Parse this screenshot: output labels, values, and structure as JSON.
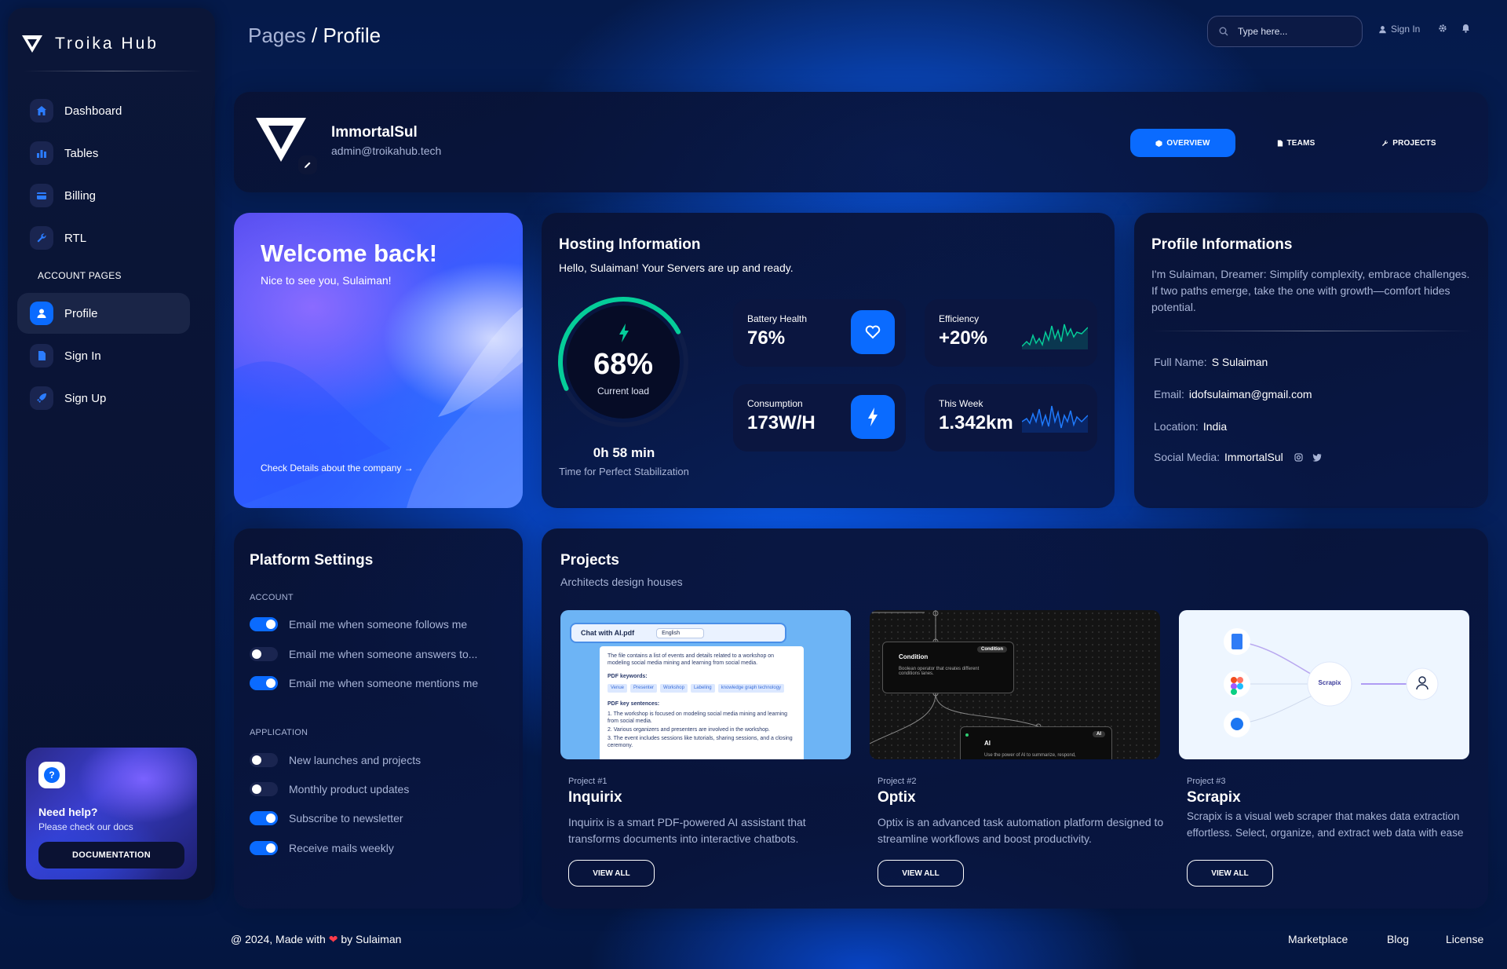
{
  "brand": {
    "title": "Troika Hub"
  },
  "sidebar": {
    "items": [
      {
        "label": "Dashboard",
        "icon": "home-icon"
      },
      {
        "label": "Tables",
        "icon": "chart-icon"
      },
      {
        "label": "Billing",
        "icon": "card-icon"
      },
      {
        "label": "RTL",
        "icon": "wrench-icon"
      }
    ],
    "section_label": "ACCOUNT PAGES",
    "account_items": [
      {
        "label": "Profile",
        "icon": "user-icon",
        "active": true
      },
      {
        "label": "Sign In",
        "icon": "document-icon"
      },
      {
        "label": "Sign Up",
        "icon": "rocket-icon"
      }
    ],
    "help": {
      "title": "Need help?",
      "subtitle": "Please check our docs",
      "button": "DOCUMENTATION",
      "icon": "question-icon"
    }
  },
  "header": {
    "breadcrumb_parent": "Pages",
    "breadcrumb_separator": "/",
    "breadcrumb_current": "Profile",
    "search_placeholder": "Type here...",
    "signin_label": "Sign In"
  },
  "profile": {
    "name": "ImmortalSul",
    "email": "admin@troikahub.tech",
    "tabs": [
      {
        "label": "OVERVIEW",
        "active": true
      },
      {
        "label": "TEAMS",
        "active": false
      },
      {
        "label": "PROJECTS",
        "active": false
      }
    ]
  },
  "welcome": {
    "title": "Welcome back!",
    "subtitle": "Nice to see you, Sulaiman!",
    "link": "Check Details about the company"
  },
  "hosting": {
    "title": "Hosting Information",
    "subtitle": "Hello, Sulaiman! Your Servers are up and ready.",
    "gauge_value": "68%",
    "gauge_fraction": 0.68,
    "gauge_label": "Current load",
    "time_value": "0h 58 min",
    "time_label": "Time for Perfect Stabilization",
    "stats": [
      {
        "label": "Battery Health",
        "value": "76%",
        "icon": "heart-icon"
      },
      {
        "label": "Efficiency",
        "value": "+20%",
        "icon": "green-sparkline"
      },
      {
        "label": "Consumption",
        "value": "173W/H",
        "icon": "bolt-icon"
      },
      {
        "label": "This Week",
        "value": "1.342km",
        "icon": "blue-sparkline"
      }
    ]
  },
  "profile_info": {
    "title": "Profile Informations",
    "description": "I'm Sulaiman, Dreamer: Simplify complexity, embrace challenges. If two paths emerge, take the one with growth—comfort hides potential.",
    "rows": [
      {
        "key": "Full Name:",
        "value": "S Sulaiman"
      },
      {
        "key": "Email:",
        "value": "idofsulaiman@gmail.com"
      },
      {
        "key": "Location:",
        "value": "India"
      },
      {
        "key": "Social Media:",
        "value": "ImmortalSul"
      }
    ]
  },
  "platform": {
    "title": "Platform Settings",
    "account_label": "ACCOUNT",
    "account": [
      {
        "label": "Email me when someone follows me",
        "on": true
      },
      {
        "label": "Email me when someone answers to...",
        "on": false
      },
      {
        "label": "Email me when someone mentions me",
        "on": true
      }
    ],
    "application_label": "APPLICATION",
    "application": [
      {
        "label": "New launches and projects",
        "on": false
      },
      {
        "label": "Monthly product updates",
        "on": false
      },
      {
        "label": "Subscribe to newsletter",
        "on": true
      },
      {
        "label": "Receive mails weekly",
        "on": true
      }
    ]
  },
  "projects": {
    "title": "Projects",
    "subtitle": "Architects design houses",
    "items": [
      {
        "num": "Project #1",
        "name": "Inquirix",
        "desc": "Inquirix is a smart PDF-powered AI assistant that transforms documents into interactive chatbots.",
        "button": "VIEW ALL"
      },
      {
        "num": "Project #2",
        "name": "Optix",
        "desc": "Optix is an advanced task automation platform designed to streamline workflows and boost productivity.",
        "button": "VIEW ALL"
      },
      {
        "num": "Project #3",
        "name": "Scrapix",
        "desc": "Scrapix is a visual web scraper that makes data extraction effortless. Select, organize, and extract web data with ease",
        "button": "VIEW ALL"
      }
    ],
    "thumb1": {
      "title": "Chat with AI.pdf",
      "lang": "English",
      "summary": "The file contains a list of events and details related to a workshop on modeling social media mining and learning from social media.",
      "keywords_label": "PDF keywords:",
      "keywords": [
        "Venue",
        "Presenter",
        "Workshop",
        "Labeling",
        "knowledge graph technology"
      ],
      "sentences_label": "PDF key sentences:",
      "sentences": [
        "1. The workshop is focused on modeling social media mining and learning from social media.",
        "2. Various organizers and presenters are involved in the workshop.",
        "3. The event includes sessions like tutorials, sharing sessions, and a closing ceremony."
      ]
    },
    "thumb2": {
      "node1_tag": "Condition",
      "node1_title": "Condition",
      "node1_desc": "Boolean operator that creates different conditions lanes.",
      "node2_tag": "AI",
      "node2_title": "AI",
      "node2_desc": "Use the power of AI to summarize, respond,"
    },
    "thumb3": {
      "center": "Scrapix"
    }
  },
  "footer": {
    "copyright_prefix": "@ 2024, Made with",
    "copyright_suffix": "by Sulaiman",
    "links": [
      "Marketplace",
      "Blog",
      "License"
    ]
  },
  "colors": {
    "accent": "#0a6bff",
    "card": "#0b1640",
    "muted": "#a8b4d6",
    "green": "#05cd99"
  }
}
